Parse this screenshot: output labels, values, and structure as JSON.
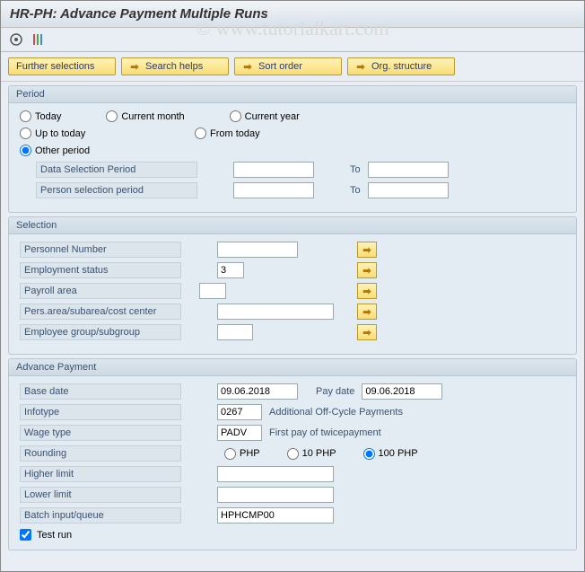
{
  "title": "HR-PH: Advance Payment Multiple Runs",
  "watermark": "© www.tutorialkart.com",
  "buttons": {
    "further": "Further selections",
    "search": "Search helps",
    "sort": "Sort order",
    "org": "Org. structure"
  },
  "period": {
    "title": "Period",
    "today": "Today",
    "current_month": "Current month",
    "current_year": "Current year",
    "up_to_today": "Up to today",
    "from_today": "From today",
    "other_period": "Other period",
    "data_sel": "Data Selection Period",
    "person_sel": "Person selection period",
    "to": "To"
  },
  "selection": {
    "title": "Selection",
    "personnel": "Personnel Number",
    "emp_status": "Employment status",
    "emp_status_val": "3",
    "payroll": "Payroll area",
    "pers_area": "Pers.area/subarea/cost center",
    "emp_group": "Employee group/subgroup"
  },
  "advance": {
    "title": "Advance Payment",
    "base_date": "Base date",
    "base_date_val": "09.06.2018",
    "pay_date": "Pay date",
    "pay_date_val": "09.06.2018",
    "infotype": "Infotype",
    "infotype_val": "0267",
    "infotype_desc": "Additional Off-Cycle Payments",
    "wage": "Wage type",
    "wage_val": "PADV",
    "wage_desc": "First pay of twicepayment",
    "rounding": "Rounding",
    "round_php": "PHP",
    "round_10": "10 PHP",
    "round_100": "100 PHP",
    "higher": "Higher limit",
    "lower": "Lower limit",
    "batch": "Batch input/queue",
    "batch_val": "HPHCMP00",
    "test": "Test run"
  }
}
